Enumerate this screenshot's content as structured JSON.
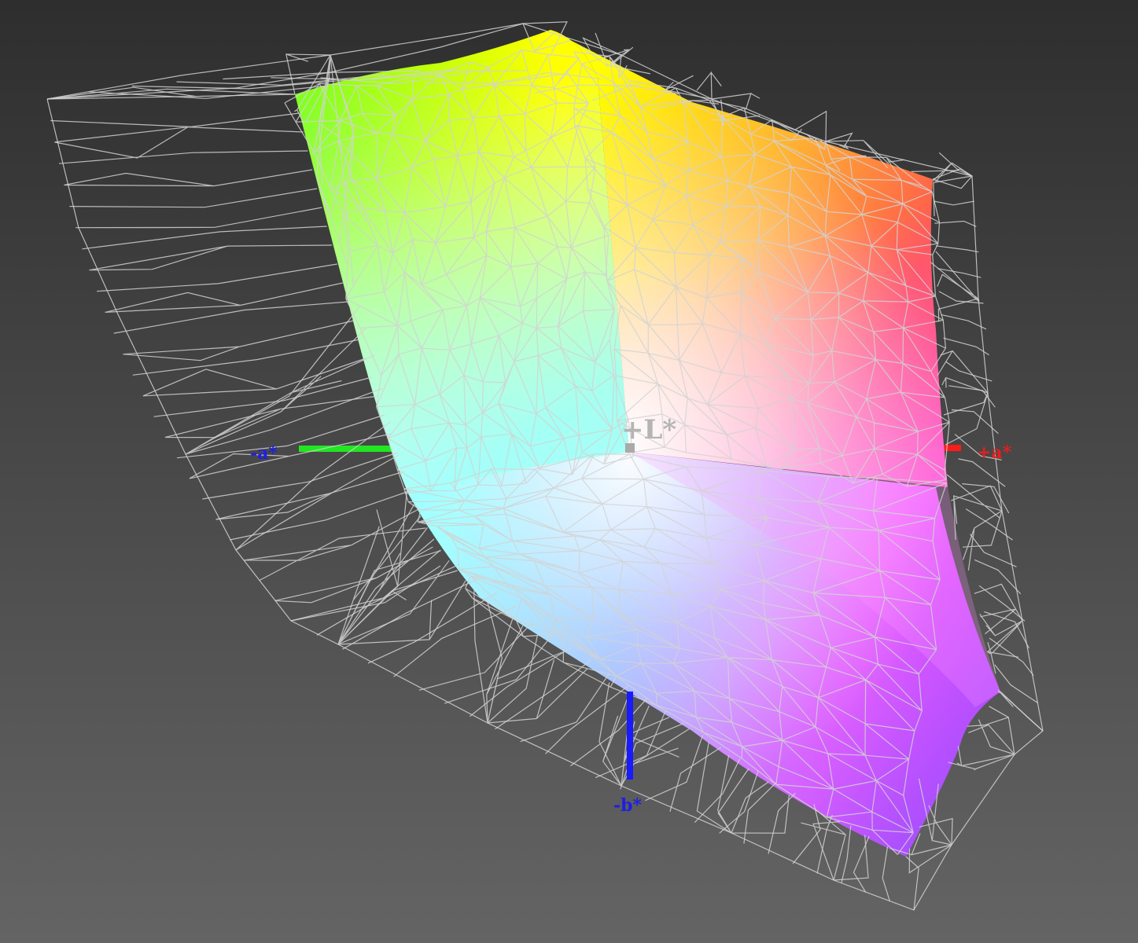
{
  "background": {
    "top_color": "#2e2e2e",
    "bottom_color": "#646464"
  },
  "axes": {
    "l_plus": {
      "label": "+L*",
      "color": "#b4b4b4"
    },
    "a_minus": {
      "label": "-a*",
      "color": "#1e1ee6",
      "line_color": "#22e622"
    },
    "a_plus": {
      "label": "+a*",
      "color": "#e61e1e",
      "line_color": "#ff1a1a"
    },
    "b_minus": {
      "label": "-b*",
      "color": "#1e1ee6",
      "line_color": "#1a1aff"
    }
  },
  "colors": {
    "wireframe": "#d2d2d2",
    "gamut_green": "#7dff1a",
    "gamut_yellow": "#ffff00",
    "gamut_orange": "#ff9a2e",
    "gamut_red": "#ff5a4a",
    "gamut_magenta": "#ff44ff",
    "gamut_violet": "#a85cff",
    "gamut_blue": "#7aa8ff",
    "gamut_cyan": "#88ffff",
    "gamut_white": "#ffffff"
  }
}
